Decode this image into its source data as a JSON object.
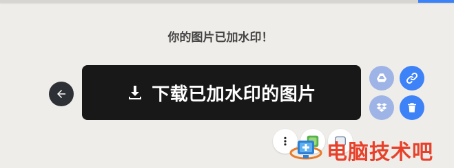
{
  "page": {
    "headline": "你的图片已加水印！",
    "download_label": "下载已加水印的图片",
    "watermark_text": "电脑技术吧"
  },
  "icons": {
    "back": "arrow-left-icon",
    "download": "download-icon",
    "drive": "google-drive-icon",
    "link": "link-icon",
    "dropbox": "dropbox-icon",
    "delete": "trash-icon",
    "more": "more-vertical-icon"
  },
  "colors": {
    "background": "#efede9",
    "download_button": "#181818",
    "back_button": "#2d3035",
    "accent_blue": "#3d82f7",
    "pale_blue": "#9fb4e6",
    "watermark_red": "#e8412a"
  }
}
